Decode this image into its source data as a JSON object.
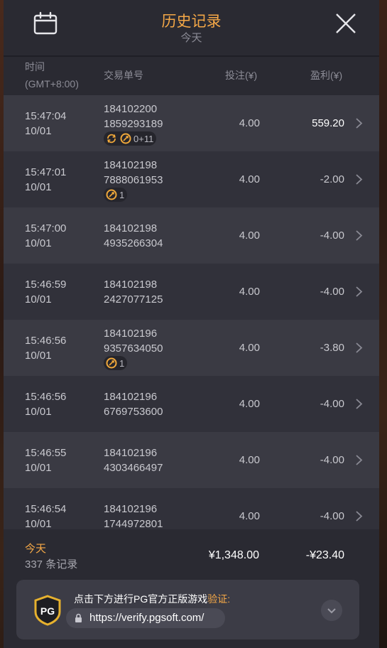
{
  "header": {
    "title": "历史记录",
    "subtitle": "今天"
  },
  "columns": {
    "time": "时间",
    "timezone": "(GMT+8:00)",
    "order": "交易单号",
    "bet": "投注(¥)",
    "profit": "盈利(¥)"
  },
  "rows": [
    {
      "time": "15:47:04",
      "date": "10/01",
      "order1": "184102200",
      "order2": "1859293189",
      "bet": "4.00",
      "profit": "559.20",
      "badge": "0+11",
      "badge_icons": [
        "refresh-icon",
        "bonus-icon"
      ]
    },
    {
      "time": "15:47:01",
      "date": "10/01",
      "order1": "184102198",
      "order2": "7888061953",
      "bet": "4.00",
      "profit": "-2.00",
      "badge": "1",
      "badge_icons": [
        "bonus-icon"
      ]
    },
    {
      "time": "15:47:00",
      "date": "10/01",
      "order1": "184102198",
      "order2": "4935266304",
      "bet": "4.00",
      "profit": "-4.00"
    },
    {
      "time": "15:46:59",
      "date": "10/01",
      "order1": "184102198",
      "order2": "2427077125",
      "bet": "4.00",
      "profit": "-4.00"
    },
    {
      "time": "15:46:56",
      "date": "10/01",
      "order1": "184102196",
      "order2": "9357634050",
      "bet": "4.00",
      "profit": "-3.80",
      "badge": "1",
      "badge_icons": [
        "bonus-icon"
      ]
    },
    {
      "time": "15:46:56",
      "date": "10/01",
      "order1": "184102196",
      "order2": "6769753600",
      "bet": "4.00",
      "profit": "-4.00"
    },
    {
      "time": "15:46:55",
      "date": "10/01",
      "order1": "184102196",
      "order2": "4303466497",
      "bet": "4.00",
      "profit": "-4.00"
    },
    {
      "time": "15:46:54",
      "date": "10/01",
      "order1": "184102196",
      "order2": "1744972801",
      "bet": "4.00",
      "profit": "-4.00"
    }
  ],
  "footer": {
    "period": "今天",
    "count": "337 条记录",
    "total_bet": "¥1,348.00",
    "total_profit": "-¥23.40"
  },
  "verify": {
    "text": "点击下方进行PG官方正版游戏",
    "highlight": "验证:",
    "url": "https://verify.pgsoft.com/",
    "logo": "PG"
  },
  "colors": {
    "accent": "#f5a847",
    "panel": "#2c2c34",
    "row_alt": "#3a3a43"
  }
}
